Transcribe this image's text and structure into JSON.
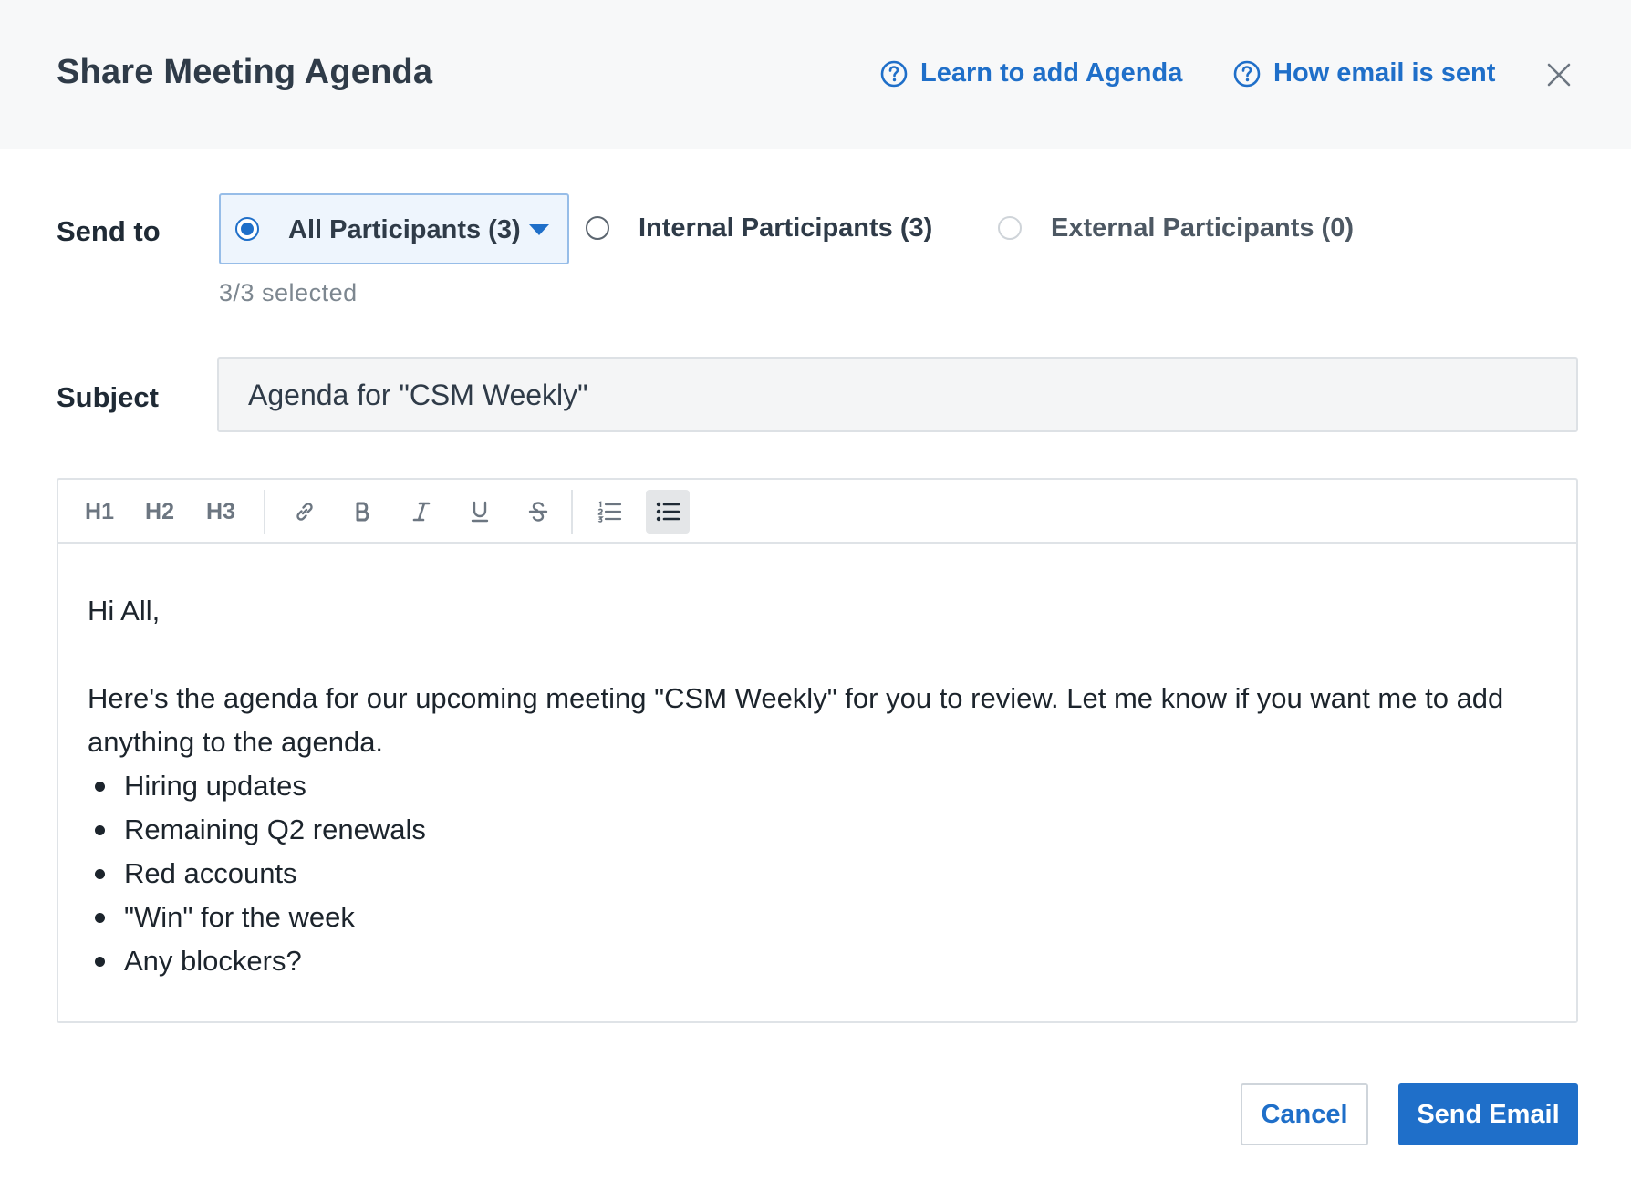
{
  "dialog": {
    "title": "Share Meeting Agenda",
    "help_links": [
      {
        "label": "Learn to add Agenda",
        "icon": "question-circle-icon"
      },
      {
        "label": "How email is sent",
        "icon": "question-circle-icon"
      }
    ],
    "close_icon": "close-icon"
  },
  "send_to": {
    "label": "Send to",
    "options": [
      {
        "label": "All Participants (3)",
        "checked": true,
        "has_dropdown": true
      },
      {
        "label": "Internal Participants (3)",
        "checked": false
      },
      {
        "label": "External Participants (0)",
        "checked": false,
        "disabled": true
      }
    ],
    "selected_count": "3/3 selected"
  },
  "subject": {
    "label": "Subject",
    "value": "Agenda for \"CSM Weekly\""
  },
  "editor": {
    "toolbar": [
      "H1",
      "H2",
      "H3",
      "link-icon",
      "bold-icon",
      "italic-icon",
      "underline-icon",
      "strikethrough-icon",
      "numbered-list-icon",
      "bulleted-list-icon"
    ],
    "active_tool": "bulleted-list-icon",
    "greeting": "Hi All,",
    "intro": "Here's the agenda for our upcoming meeting \"CSM Weekly\" for you to review. Let me know if you want me to add anything to the agenda.",
    "items": [
      "Hiring updates",
      "Remaining Q2 renewals",
      "Red accounts",
      "\"Win\" for the week",
      "Any blockers?"
    ]
  },
  "footer": {
    "cancel_label": "Cancel",
    "send_label": "Send Email"
  },
  "colors": {
    "accent": "#1f6fc9",
    "header_bg": "#f7f8f9",
    "text": "#2f3b48"
  }
}
